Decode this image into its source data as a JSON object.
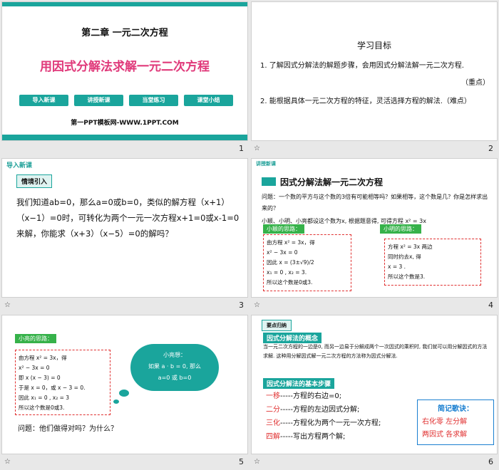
{
  "slides": [
    {
      "number": "1",
      "chapter": "第二章 一元二次方程",
      "title": "用因式分解法求解一元二次方程",
      "nav": [
        "导入新课",
        "讲授新课",
        "当堂练习",
        "课堂小结"
      ],
      "site": "第一PPT模板网-WWW.1PPT.COM"
    },
    {
      "number": "2",
      "heading": "学习目标",
      "goal1": "1. 了解因式分解法的解题步骤，会用因式分解法解一元二次方程.",
      "goal1_tag": "（重点）",
      "goal2": "2. 能根据具体一元二次方程的特征，灵活选择方程的解法.（难点）"
    },
    {
      "number": "3",
      "section": "导入新课",
      "label": "情境引入",
      "text": "我们知道ab=0，那么a=0或b=0，类似的解方程（x+1）（x−1）=0时，可转化为两个一元一次方程x+1=0或x-1=0来解，你能求（x+3）（x−5）=0的解吗？"
    },
    {
      "number": "4",
      "section": "讲授新课",
      "heading": "因式分解法解一元二次方程",
      "question": "问题：一个数的平方与这个数的3倍有可能相等吗？如果相等，这个数是几？你是怎样求出来的？",
      "intro": "小颖、小明、小亮都设这个数为x, 根据题意得, 可得方程 x² = 3x",
      "ying_label": "小颖的思路：",
      "ying_lines": [
        "由方程 x² = 3x，得",
        "x² − 3x = 0",
        "因此  x = (3±√9)/2",
        "x₁ = 0 , x₂ = 3.",
        "所以这个数是0或3."
      ],
      "ming_label": "小明的思路：",
      "ming_lines": [
        "方程 x² = 3x 两边",
        "同时约去x, 得",
        "x = 3 .",
        "所以这个数是3."
      ]
    },
    {
      "number": "5",
      "liang_label": "小亮的思路：",
      "liang_lines": [
        "由方程 x² = 3x，得",
        "x² − 3x = 0",
        "即  x (x − 3) = 0",
        "于是 x = 0，或 x − 3 = 0.",
        "因此  x₁ = 0 , x₂ = 3",
        "所以这个数是0或3."
      ],
      "cloud_lines": [
        "小亮想：",
        "如果 a · b = 0, 那么",
        "a=0 或 b=0"
      ],
      "question": "问题：他们做得对吗？为什么？"
    },
    {
      "number": "6",
      "section": "要点归纳",
      "concept_label": "因式分解法的概念",
      "concept_text": "当一元二次方程的一边是0, 而另一边易于分解成两个一次因式的乘积时, 我们就可以用分解因式的方法求解. 这种用分解因式解一元二次方程的方法称为因式分解法.",
      "steps_label": "因式分解法的基本步骤",
      "steps": [
        {
          "k": "一移",
          "v": "-----方程的右边=0;"
        },
        {
          "k": "二分",
          "v": "-----方程的左边因式分解;"
        },
        {
          "k": "三化",
          "v": "-----方程化为两个一元一次方程;"
        },
        {
          "k": "四解",
          "v": "-----写出方程两个解;"
        }
      ],
      "tip_title": "简记歌诀：",
      "tip_lines": [
        "右化零   左分解",
        "两因式   各求解"
      ]
    }
  ]
}
